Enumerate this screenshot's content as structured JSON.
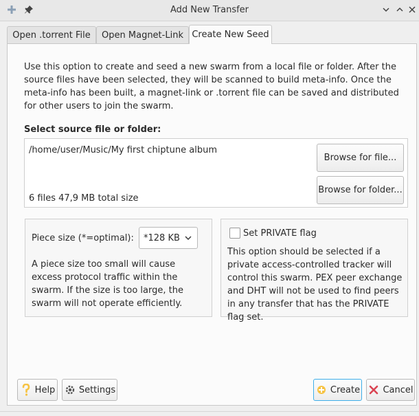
{
  "window": {
    "title": "Add New Transfer",
    "icons": [
      "add-icon",
      "pin-icon",
      "chevron-down-icon",
      "chevron-up-icon",
      "close-icon"
    ]
  },
  "tabs": [
    {
      "label": "Open .torrent File",
      "active": false
    },
    {
      "label": "Open Magnet-Link",
      "active": false
    },
    {
      "label": "Create New Seed",
      "active": true
    }
  ],
  "main": {
    "description": "Use this option to create and seed a new swarm from a local file or folder.  After the source files have been selected, they will be scanned to build meta-info.  Once the meta-info has been built, a magnet-link or .torrent file can be saved and distributed for other users to join the swarm.",
    "source_label": "Select source file or folder:",
    "source_path": "/home/user/Music/My first chiptune album",
    "source_summary": "6 files  47,9 MB total size",
    "browse_file_label": "Browse for file...",
    "browse_folder_label": "Browse for folder..."
  },
  "piece": {
    "label": "Piece size (*=optimal):",
    "selected": "*128 KB",
    "description": "A piece size too small will cause excess protocol traffic within the swarm.  If the size is too large, the swarm will not operate efficiently."
  },
  "private": {
    "label": "Set PRIVATE flag",
    "checked": false,
    "description": "This option should be selected if a private access-controlled tracker will control this swarm.  PEX peer exchange and DHT will not be used to find peers in any transfer that has the PRIVATE flag set."
  },
  "footer": {
    "help_label": "Help",
    "settings_label": "Settings",
    "create_label": "Create",
    "cancel_label": "Cancel"
  },
  "colors": {
    "accent": "#3daee9",
    "cancel_icon": "#da4453",
    "help_icon": "#f6c343"
  }
}
